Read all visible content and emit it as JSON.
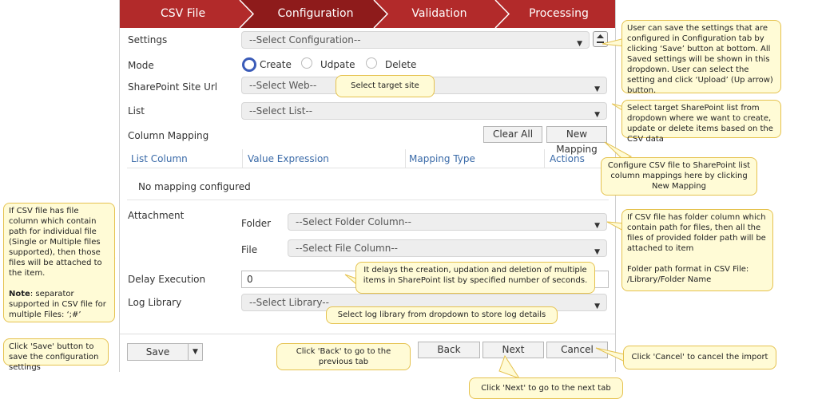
{
  "wizard": {
    "steps": [
      "CSV File",
      "Configuration",
      "Validation",
      "Processing"
    ]
  },
  "form": {
    "settings_label": "Settings",
    "settings_value": "--Select Configuration--",
    "mode_label": "Mode",
    "mode_options": [
      "Create",
      "Udpate",
      "Delete"
    ],
    "site_label": "SharePoint Site Url",
    "site_value": "--Select Web--",
    "list_label": "List",
    "list_value": "--Select List--",
    "mapping_label": "Column Mapping",
    "clear_all": "Clear All",
    "new_mapping": "New Mapping",
    "table_headers": [
      "List Column",
      "Value Expression",
      "Mapping Type",
      "Actions"
    ],
    "no_mapping": "No mapping configured",
    "attachment_label": "Attachment",
    "folder_label": "Folder",
    "folder_value": "--Select Folder Column--",
    "file_label": "File",
    "file_value": "--Select File Column--",
    "delay_label": "Delay Execution",
    "delay_value": "0",
    "log_label": "Log Library",
    "log_value": "--Select Library--"
  },
  "footer": {
    "save": "Save",
    "back": "Back",
    "next": "Next",
    "cancel": "Cancel"
  },
  "callouts": {
    "settings": "User can save the settings that are configured in Configuration tab by clicking ‘Save’ button at bottom. All Saved settings will be shown in this dropdown. User can select the setting and click ‘Upload’ (Up arrow) button.",
    "site": "Select target site",
    "list": "Select target SharePoint list from dropdown where we want to create, update or delete items based on the CSV data",
    "mapping": "Configure CSV file to SharePoint list column mappings here by clicking New Mapping",
    "file": "If CSV file has file column which contain path for individual file (Single or Multiple files supported), then those files will be attached to the item.",
    "file_note_label": "Note",
    "file_note": ": separator supported in CSV file for multiple Files: ‘;#’",
    "folder": "If CSV file has folder column which contain path for files, then all the files of provided folder path will be attached to item",
    "folder_format": "Folder path format in CSV File: /Library/Folder Name",
    "delay": "It delays the creation, updation and deletion of multiple items in SharePoint list by specified number of seconds.",
    "log": "Select log library from dropdown to store log details",
    "save": "Click 'Save' button to save the configuration settings",
    "back": "Click 'Back' to go to the previous tab",
    "next": "Click 'Next' to go to the next tab",
    "cancel": "Click 'Cancel' to cancel the import"
  },
  "icons": {
    "upload": "upload-icon",
    "dropdown": "chevron-down-icon"
  },
  "colors": {
    "wizard_active": "#8e1b1b",
    "wizard": "#b22a2a",
    "callout_bg": "#fffbd6",
    "callout_border": "#e5c24f",
    "radio_selected": "#3a5bb8"
  }
}
